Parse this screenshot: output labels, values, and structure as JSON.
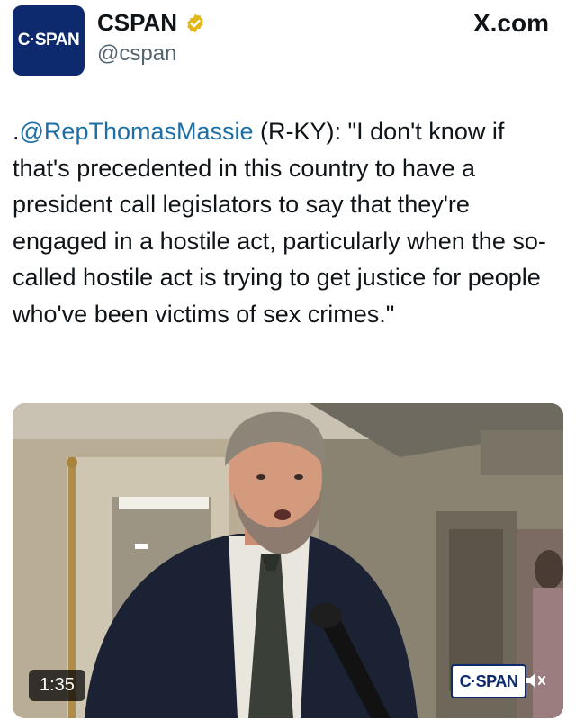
{
  "header": {
    "avatar_text": "C·SPAN",
    "display_name": "CSPAN",
    "handle": "@cspan",
    "site": "X.com"
  },
  "tweet": {
    "prefix": ".",
    "mention": "@RepThomasMassie",
    "text": " (R-KY): \"I don't know if that's precedented in this country to have a president call legislators to say that they're engaged in a hostile act, particularly when the so-called hostile act is trying to get justice for people who've been victims of sex crimes.\""
  },
  "media": {
    "duration": "1:35",
    "watermark": "C·SPAN"
  },
  "colors": {
    "brand_navy": "#0d2a6e",
    "verified_gold": "#e2b719",
    "mention_blue": "#1d6fa5"
  },
  "icons": [
    "verified-badge-icon",
    "mute-icon"
  ]
}
